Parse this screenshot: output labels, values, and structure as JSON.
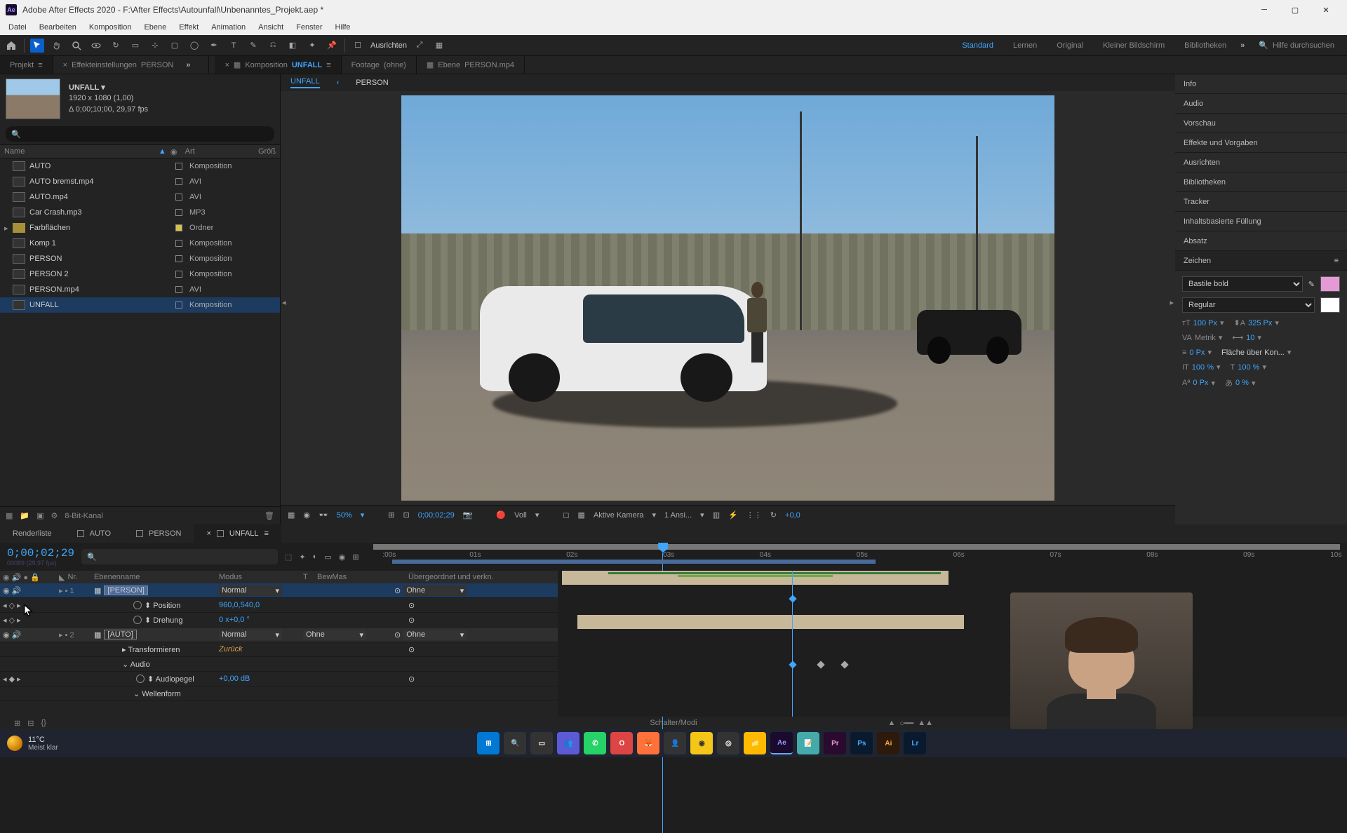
{
  "title": "Adobe After Effects 2020 - F:\\After Effects\\Autounfall\\Unbenanntes_Projekt.aep *",
  "menu": [
    "Datei",
    "Bearbeiten",
    "Komposition",
    "Ebene",
    "Effekt",
    "Animation",
    "Ansicht",
    "Fenster",
    "Hilfe"
  ],
  "toolbar_align": "Ausrichten",
  "workspaces": [
    "Standard",
    "Lernen",
    "Original",
    "Kleiner Bildschirm",
    "Bibliotheken"
  ],
  "search_help": "Hilfe durchsuchen",
  "doctabs": {
    "proj": "Projekt",
    "fx_label": "Effekteinstellungen",
    "fx_val": "PERSON",
    "komp_label": "Komposition",
    "komp_val": "UNFALL",
    "footage_label": "Footage",
    "footage_val": "(ohne)",
    "ebene_label": "Ebene",
    "ebene_val": "PERSON.mp4"
  },
  "proj": {
    "name": "UNFALL ▾",
    "dims": "1920 x 1080 (1,00)",
    "dur": "Δ 0;00;10;00, 29,97 fps",
    "cols": {
      "name": "Name",
      "type": "Art",
      "size": "Größ"
    },
    "items": [
      {
        "name": "AUTO",
        "type": "Komposition",
        "dot": ""
      },
      {
        "name": "AUTO bremst.mp4",
        "type": "AVI",
        "dot": ""
      },
      {
        "name": "AUTO.mp4",
        "type": "AVI",
        "dot": ""
      },
      {
        "name": "Car Crash.mp3",
        "type": "MP3",
        "dot": ""
      },
      {
        "name": "Farbflächen",
        "type": "Ordner",
        "dot": "y",
        "folder": true
      },
      {
        "name": "Komp 1",
        "type": "Komposition",
        "dot": ""
      },
      {
        "name": "PERSON",
        "type": "Komposition",
        "dot": ""
      },
      {
        "name": "PERSON 2",
        "type": "Komposition",
        "dot": ""
      },
      {
        "name": "PERSON.mp4",
        "type": "AVI",
        "dot": ""
      },
      {
        "name": "UNFALL",
        "type": "Komposition",
        "dot": "",
        "sel": true
      }
    ],
    "bits": "8-Bit-Kanal"
  },
  "viewer": {
    "subtabs": [
      "UNFALL",
      "‹",
      "PERSON"
    ],
    "zoom": "50%",
    "tc": "0;00;02;29",
    "res": "Voll",
    "cam": "Aktive Kamera",
    "views": "1 Ansi...",
    "exp": "+0,0"
  },
  "rightPanels": [
    "Info",
    "Audio",
    "Vorschau",
    "Effekte und Vorgaben",
    "Ausrichten",
    "Bibliotheken",
    "Tracker",
    "Inhaltsbasierte Füllung",
    "Absatz",
    "Zeichen"
  ],
  "char": {
    "font": "Bastile bold",
    "style": "Regular",
    "size": "100 Px",
    "leading": "325 Px",
    "kerning": "Metrik",
    "tracking": "10",
    "stroke": "0 Px",
    "fill_over": "Fläche über Kon...",
    "vscale": "100 %",
    "hscale": "100 %",
    "baseline": "0 Px",
    "tsume": "0 %"
  },
  "timeline": {
    "tabs": [
      "Renderliste",
      "AUTO",
      "PERSON",
      "UNFALL"
    ],
    "tc": "0;00;02;29",
    "sub": "00089 (29,97 fps)",
    "headers": {
      "nr": "Nr.",
      "name": "Ebenenname",
      "mode": "Modus",
      "t": "T",
      "trk": "BewMas",
      "parent": "Übergeordnet und verkn."
    },
    "ruler": [
      ":00s",
      "01s",
      "02s",
      "03s",
      "04s",
      "05s",
      "06s",
      "07s",
      "08s",
      "09s",
      "10s"
    ],
    "layers": [
      {
        "nr": "1",
        "name": "[PERSON]",
        "mode": "Normal",
        "trk": "",
        "parent": "Ohne",
        "sel": true
      },
      {
        "prop": "Position",
        "val": "960,0,540,0"
      },
      {
        "prop": "Drehung",
        "val": "0 x+0,0 °"
      },
      {
        "nr": "2",
        "name": "[AUTO]",
        "mode": "Normal",
        "trk": "Ohne",
        "parent": "Ohne"
      },
      {
        "prop": "Transformieren",
        "val": "Zurück",
        "ital": true
      },
      {
        "prop": "Audio",
        "group": true
      },
      {
        "prop": "Audiopegel",
        "val": "+0,00 dB"
      },
      {
        "prop": "Wellenform",
        "group": true
      }
    ],
    "modes": "Schalter/Modi"
  },
  "weather": {
    "temp": "11°C",
    "desc": "Meist klar"
  }
}
